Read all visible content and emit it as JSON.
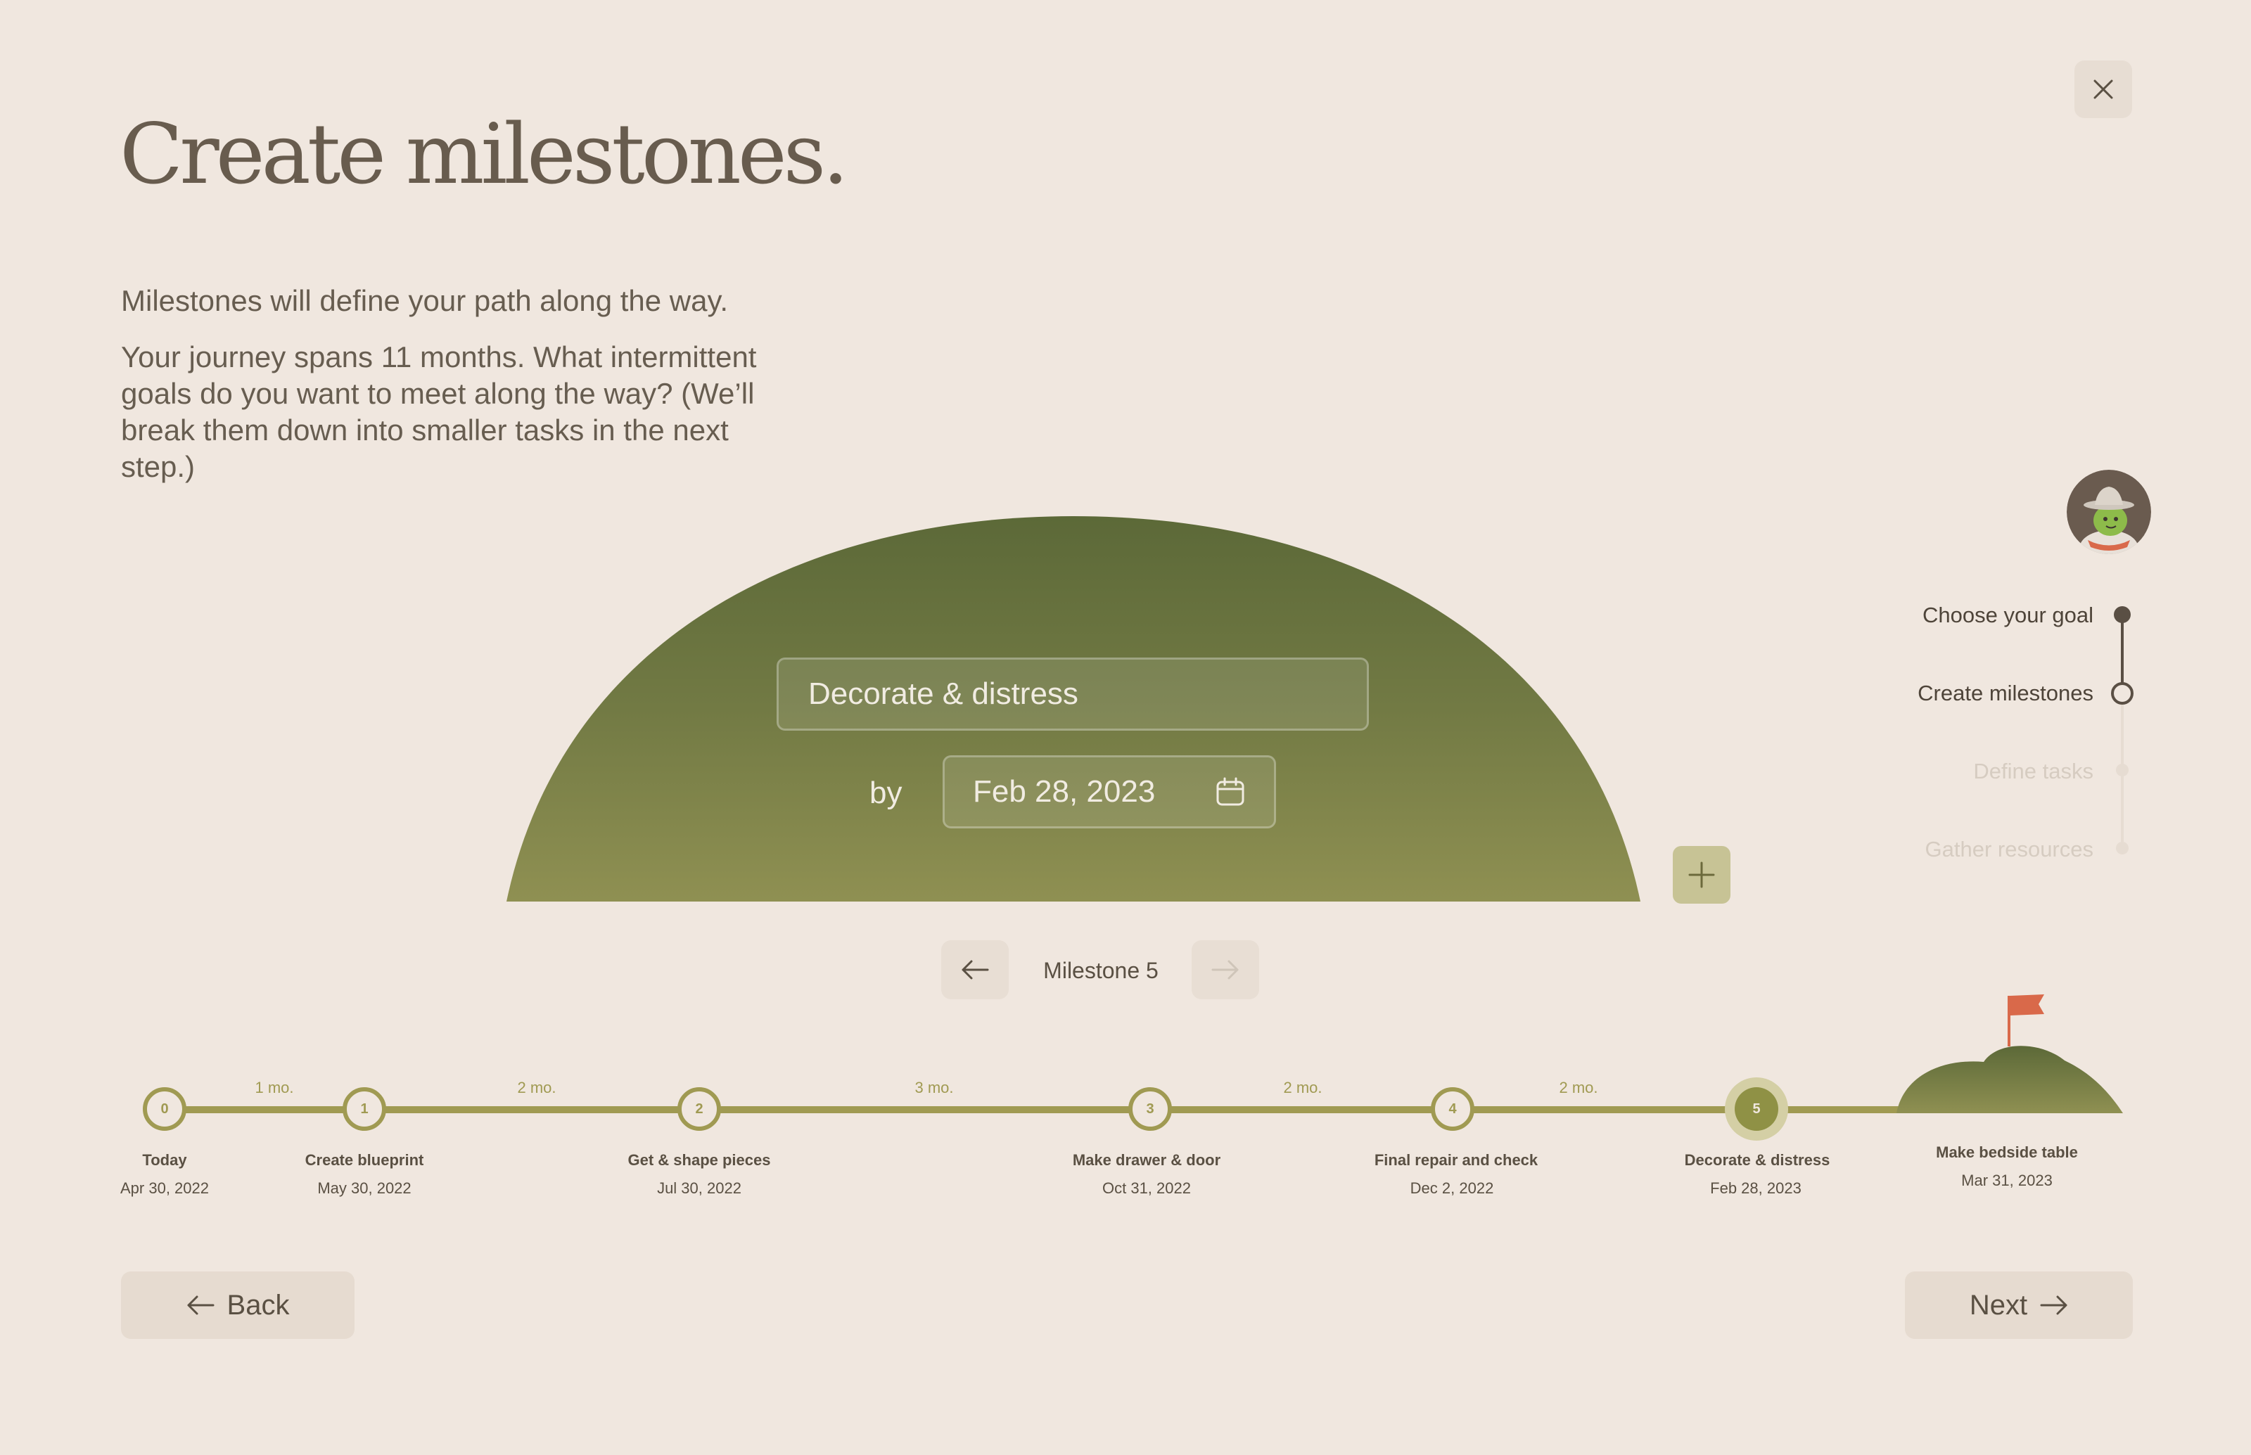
{
  "header": {
    "title": "Create milestones.",
    "intro": "Milestones will define your path along the way.",
    "description": "Your journey spans 11 months. What intermittent goals do you want to meet along the way? (We’ll break them down into smaller tasks in the next step.)"
  },
  "editor": {
    "milestone_name": "Decorate & distress",
    "by_label": "by",
    "date_value": "Feb 28, 2023",
    "nav_label": "Milestone 5"
  },
  "stepper": {
    "steps": [
      {
        "label": "Choose your goal",
        "state": "done"
      },
      {
        "label": "Create milestones",
        "state": "current"
      },
      {
        "label": "Define tasks",
        "state": "upcoming"
      },
      {
        "label": "Gather resources",
        "state": "upcoming"
      }
    ]
  },
  "timeline": {
    "milestones": [
      {
        "number": "0",
        "name": "Today",
        "date": "Apr 30, 2022"
      },
      {
        "number": "1",
        "name": "Create blueprint",
        "date": "May 30, 2022"
      },
      {
        "number": "2",
        "name": "Get & shape pieces",
        "date": "Jul 30, 2022"
      },
      {
        "number": "3",
        "name": "Make drawer & door",
        "date": "Oct 31, 2022"
      },
      {
        "number": "4",
        "name": "Final repair and check",
        "date": "Dec 2, 2022"
      },
      {
        "number": "5",
        "name": "Decorate & distress",
        "date": "Feb 28, 2023",
        "active": true
      }
    ],
    "gaps": [
      "1 mo.",
      "2 mo.",
      "3 mo.",
      "2 mo.",
      "2 mo."
    ],
    "goal": {
      "name": "Make bedside table",
      "date": "Mar 31, 2023"
    }
  },
  "footer": {
    "back_label": "Back",
    "next_label": "Next"
  },
  "icons": {
    "close": "close-icon",
    "calendar": "calendar-icon",
    "add": "plus-icon",
    "prev": "arrow-left-icon",
    "next": "arrow-right-icon",
    "flag": "flag-icon"
  },
  "colors": {
    "background": "#f0e7df",
    "hill_top": "#5f6b3a",
    "hill_bottom": "#8d8f52",
    "timeline": "#a09a52",
    "flag": "#d9694a",
    "text": "#675d50"
  }
}
